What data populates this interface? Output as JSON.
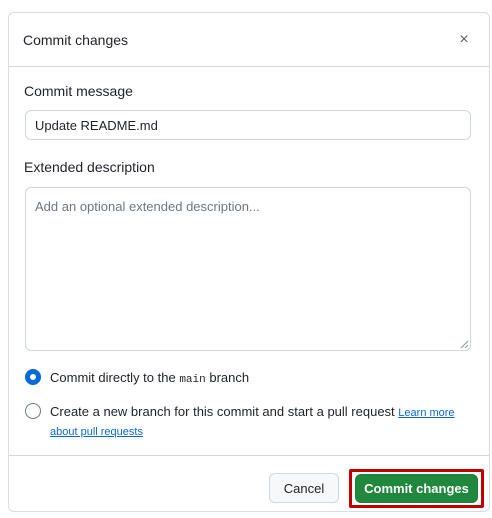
{
  "dialog": {
    "title": "Commit changes",
    "close_symbol": "×"
  },
  "commit_message": {
    "label": "Commit message",
    "value": "Update README.md"
  },
  "extended_description": {
    "label": "Extended description",
    "placeholder": "Add an optional extended description..."
  },
  "options": {
    "direct": {
      "text_before": "Commit directly to the",
      "branch": "main",
      "text_after": "branch",
      "checked": true
    },
    "new_branch": {
      "text": "Create a new branch for this commit and start a pull request",
      "link_text": "Learn more about pull requests",
      "checked": false
    }
  },
  "buttons": {
    "cancel": "Cancel",
    "commit": "Commit changes"
  },
  "colors": {
    "primary_green": "#1f883d",
    "radio_blue": "#0969da",
    "highlight_red": "#c00000"
  }
}
